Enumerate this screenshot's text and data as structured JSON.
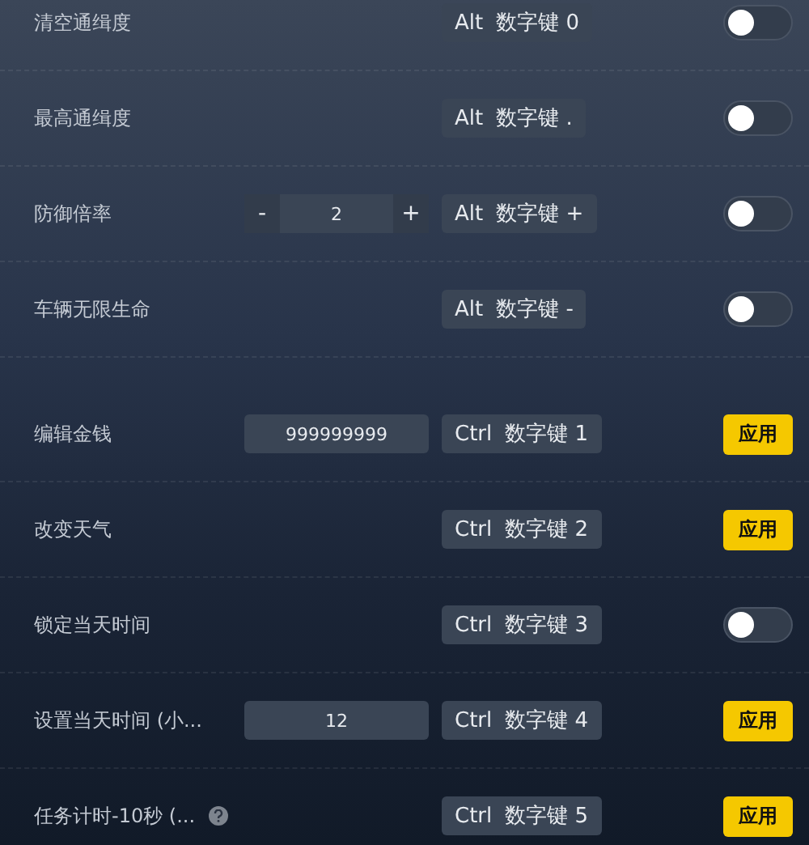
{
  "sections": [
    {
      "rows": [
        {
          "label": "清空通缉度",
          "hotkey": {
            "modifier": "Alt",
            "key": "数字键 0"
          },
          "action": {
            "kind": "toggle",
            "on": false
          }
        },
        {
          "label": "最高通缉度",
          "hotkey": {
            "modifier": "Alt",
            "key": "数字键 ."
          },
          "action": {
            "kind": "toggle",
            "on": false
          }
        },
        {
          "label": "防御倍率",
          "control": {
            "kind": "stepper",
            "minus": "-",
            "value": "2",
            "plus": "+"
          },
          "hotkey": {
            "modifier": "Alt",
            "key": "数字键 +"
          },
          "action": {
            "kind": "toggle",
            "on": false
          }
        },
        {
          "label": "车辆无限生命",
          "hotkey": {
            "modifier": "Alt",
            "key": "数字键 -"
          },
          "action": {
            "kind": "toggle",
            "on": false
          }
        }
      ]
    },
    {
      "rows": [
        {
          "label": "编辑金钱",
          "control": {
            "kind": "input",
            "value": "999999999"
          },
          "hotkey": {
            "modifier": "Ctrl",
            "key": "数字键 1"
          },
          "action": {
            "kind": "button",
            "label": "应用"
          }
        },
        {
          "label": "改变天气",
          "hotkey": {
            "modifier": "Ctrl",
            "key": "数字键 2"
          },
          "action": {
            "kind": "button",
            "label": "应用"
          }
        },
        {
          "label": "锁定当天时间",
          "hotkey": {
            "modifier": "Ctrl",
            "key": "数字键 3"
          },
          "action": {
            "kind": "toggle",
            "on": false
          }
        },
        {
          "label": "设置当天时间 (小...",
          "control": {
            "kind": "input",
            "value": "12"
          },
          "hotkey": {
            "modifier": "Ctrl",
            "key": "数字键 4"
          },
          "action": {
            "kind": "button",
            "label": "应用"
          }
        },
        {
          "label": "任务计时-10秒 (...",
          "help": true,
          "hotkey": {
            "modifier": "Ctrl",
            "key": "数字键 5"
          },
          "action": {
            "kind": "button",
            "label": "应用"
          }
        }
      ]
    }
  ]
}
